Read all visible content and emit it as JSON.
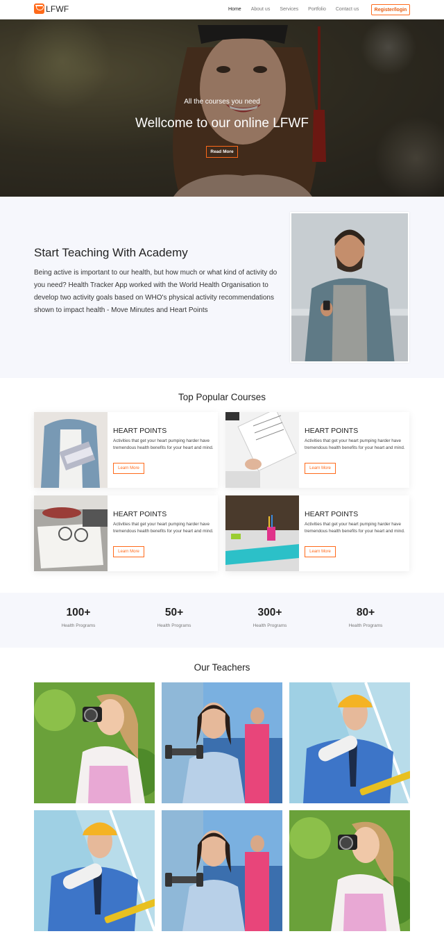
{
  "nav": {
    "logo_text": "LFWF",
    "items": [
      {
        "label": "Home",
        "active": true
      },
      {
        "label": "About us",
        "active": false
      },
      {
        "label": "Services",
        "active": false
      },
      {
        "label": "Portfolio",
        "active": false
      },
      {
        "label": "Contact us",
        "active": false
      }
    ],
    "register_label": "Register/login"
  },
  "hero": {
    "subtitle": "All the courses you need",
    "title": "Wellcome to our online LFWF",
    "button_label": "Read More"
  },
  "about": {
    "title": "Start Teaching With Academy",
    "text": "Being active is important to our health, but how much or what kind of activity do you need? Health Tracker App worked with the World Health Organisation to develop two activity goals based on WHO's physical activity recommendations shown to impact health - Move Minutes and Heart Points"
  },
  "courses": {
    "title": "Top Popular Courses",
    "cards": [
      {
        "title": "HEART POINTS",
        "text": "Activities that get your heart pumping harder have tremendous health benefits for your heart and mind.",
        "button": "Learn More"
      },
      {
        "title": "HEART POINTS",
        "text": "Activities that get your heart pumping harder have tremendous health benefits for your heart and mind.",
        "button": "Learn More"
      },
      {
        "title": "HEART POINTS",
        "text": "Activities that get your heart pumping harder have tremendous health benefits for your heart and mind.",
        "button": "Learn More"
      },
      {
        "title": "HEART POINTS",
        "text": "Activities that get your heart pumping harder have tremendous health benefits for your heart and mind.",
        "button": "Learn More"
      }
    ]
  },
  "stats": [
    {
      "value": "100+",
      "label": "Health Programs"
    },
    {
      "value": "50+",
      "label": "Health Programs"
    },
    {
      "value": "300+",
      "label": "Health Programs"
    },
    {
      "value": "80+",
      "label": "Health Programs"
    }
  ],
  "teachers": {
    "title": "Our Teachers"
  },
  "colors": {
    "accent": "#ff6a1a",
    "section_bg": "#f6f7fc"
  }
}
